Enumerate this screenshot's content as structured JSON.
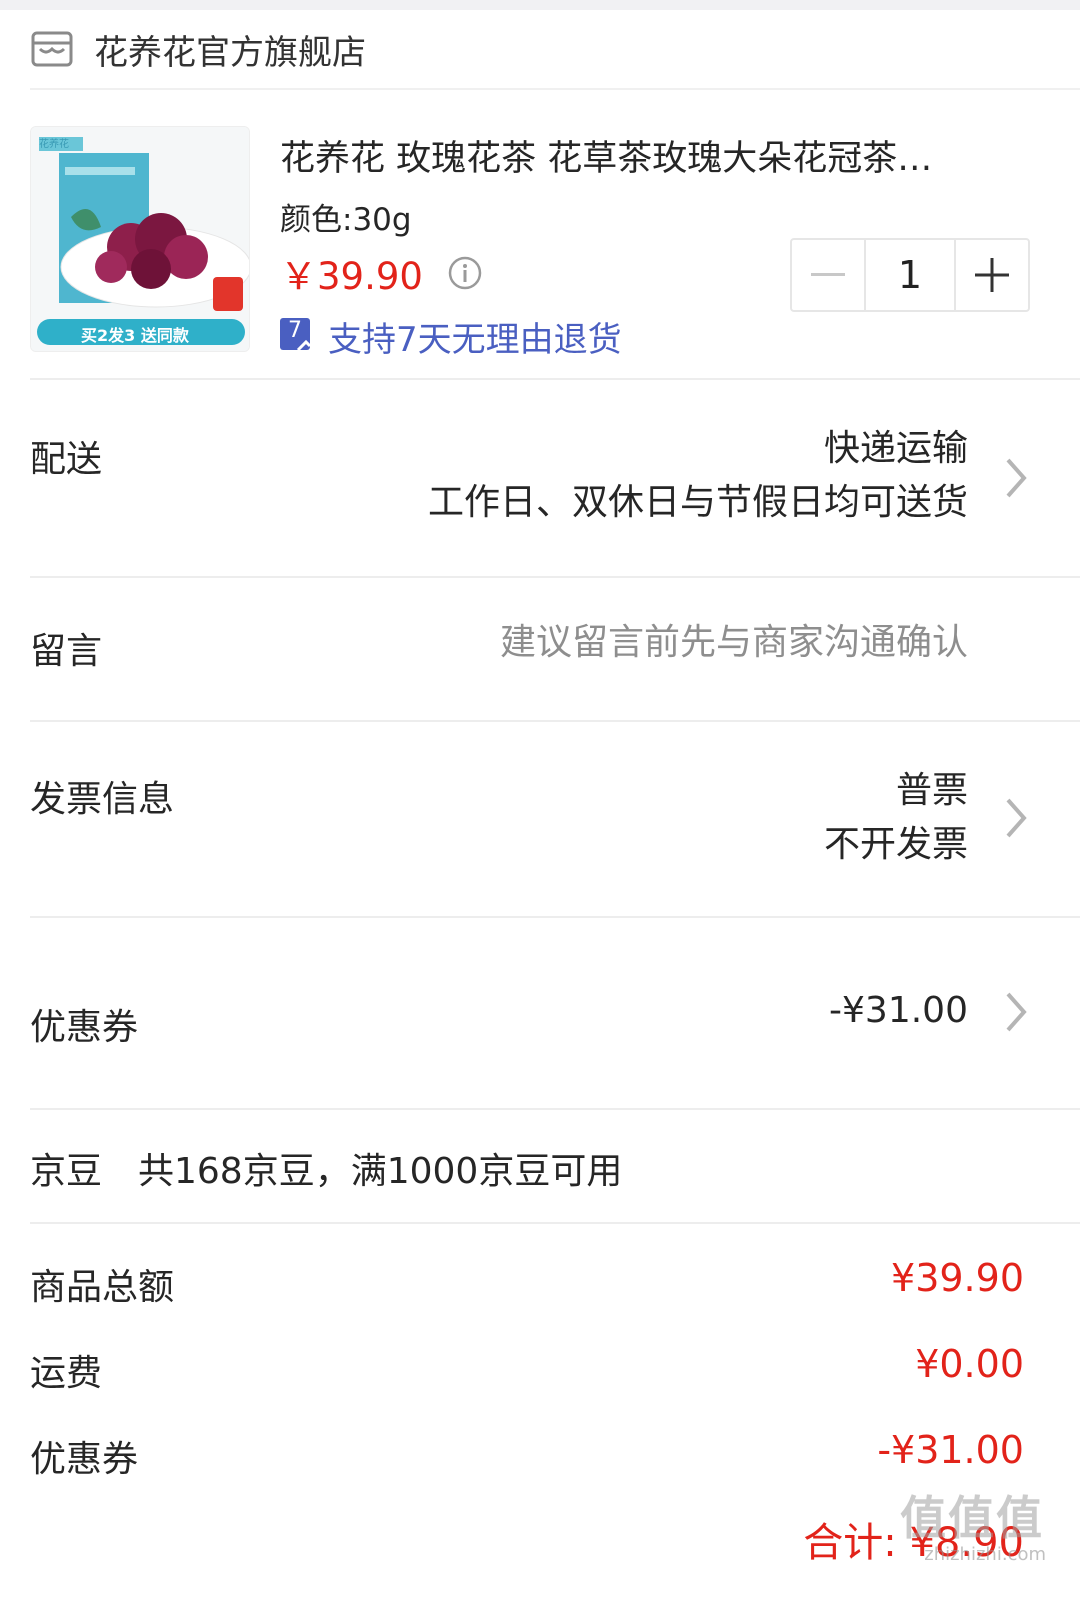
{
  "shop": {
    "name": "花养花官方旗舰店",
    "icon": "store-icon"
  },
  "product": {
    "title": "花养花 玫瑰花茶 花草茶玫瑰大朵花冠茶…",
    "spec": "颜色:30g",
    "price": "￥39.90",
    "return_policy": "支持7天无理由退货",
    "badge_number": "7",
    "thumb_banner": "买2发3 送同款",
    "thumb_brand": "花养花",
    "quantity": "1"
  },
  "delivery": {
    "label": "配送",
    "method": "快递运输",
    "detail": "工作日、双休日与节假日均可送货"
  },
  "message": {
    "label": "留言",
    "placeholder": "建议留言前先与商家沟通确认"
  },
  "invoice": {
    "label": "发票信息",
    "type": "普票",
    "detail": "不开发票"
  },
  "coupon": {
    "label": "优惠券",
    "value": "-¥31.00"
  },
  "jingdou": {
    "label": "京豆",
    "detail": "共168京豆，满1000京豆可用"
  },
  "summary": {
    "items": [
      {
        "label": "商品总额",
        "value": "¥39.90"
      },
      {
        "label": "运费",
        "value": "¥0.00"
      },
      {
        "label": "优惠券",
        "value": "-¥31.00"
      }
    ],
    "total": "合计: ¥8.90"
  },
  "watermark": {
    "text": "值值值",
    "url": "zhizhizhi.com"
  },
  "colors": {
    "accent_red": "#e2231a",
    "link_blue": "#4a5fc1",
    "hint_gray": "#8e8e8e"
  }
}
